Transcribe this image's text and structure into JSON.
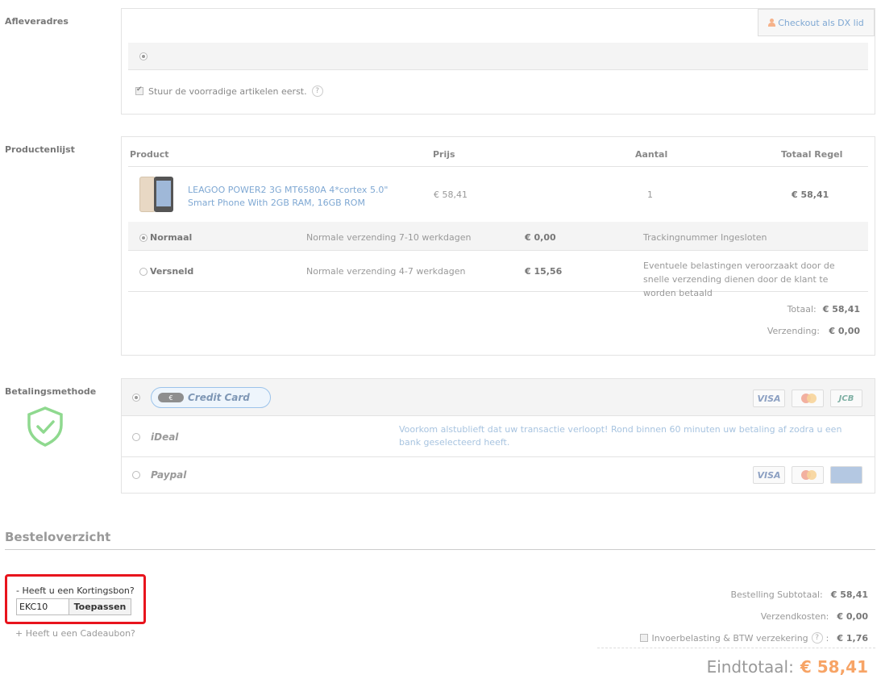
{
  "address": {
    "label": "Afleveradres",
    "dx_button": "Checkout als DX lid",
    "stock_first": "Stuur de voorradige artikelen eerst."
  },
  "products": {
    "label": "Productenlijst",
    "headers": [
      "Product",
      "Prijs",
      "Aantal",
      "Totaal Regel"
    ],
    "item": {
      "name": "LEAGOO POWER2 3G MT6580A 4*cortex 5.0\" Smart Phone With 2GB RAM, 16GB ROM",
      "price": "€ 58,41",
      "qty": "1",
      "total": "€ 58,41"
    },
    "shipping": [
      {
        "name": "Normaal",
        "desc": "Normale verzending 7-10 werkdagen",
        "price": "€ 0,00",
        "note": "Trackingnummer Ingesloten",
        "selected": true
      },
      {
        "name": "Versneld",
        "desc": "Normale verzending 4-7 werkdagen",
        "price": "€ 15,56",
        "note": "Eventuele belastingen veroorzaakt door de snelle verzending dienen door de klant te worden betaald",
        "selected": false
      }
    ],
    "totaal_label": "Totaal:",
    "totaal_value": "€ 58,41",
    "verzending_label": "Verzending:",
    "verzending_value": "€ 0,00"
  },
  "payment": {
    "label": "Betalingsmethode",
    "methods": [
      {
        "name": "Credit Card",
        "chip": "€",
        "logos": [
          "VISA",
          "mastercard",
          "JCB"
        ],
        "selected": true
      },
      {
        "name": "iDeal",
        "note": "Voorkom alstublieft dat uw transactie verloopt! Rond binnen 60 minuten uw betaling af zodra u een bank geselecteerd heeft.",
        "selected": false
      },
      {
        "name": "Paypal",
        "logos": [
          "VISA",
          "mastercard",
          "AMERICAN EXPRESS"
        ],
        "selected": false
      }
    ],
    "accent_color": "#9cc3ea",
    "shield_color": "#8fd98f"
  },
  "overview": {
    "title": "Besteloverzicht",
    "coupon_title": "- Heeft u een Kortingsbon?",
    "coupon_value": "EKC10",
    "coupon_button": "Toepassen",
    "gift_link": "+ Heeft u een Cadeaubon?",
    "subtotal_label": "Bestelling Subtotaal:",
    "subtotal_value": "€ 58,41",
    "shipping_label": "Verzendkosten:",
    "shipping_value": "€ 0,00",
    "insurance_label": "Invoerbelasting & BTW verzekering",
    "insurance_value": "€ 1,76",
    "grand_label": "Eindtotaal:",
    "grand_value": "€ 58,41",
    "highlight_color": "#e8141d",
    "total_color": "#f7a466"
  }
}
